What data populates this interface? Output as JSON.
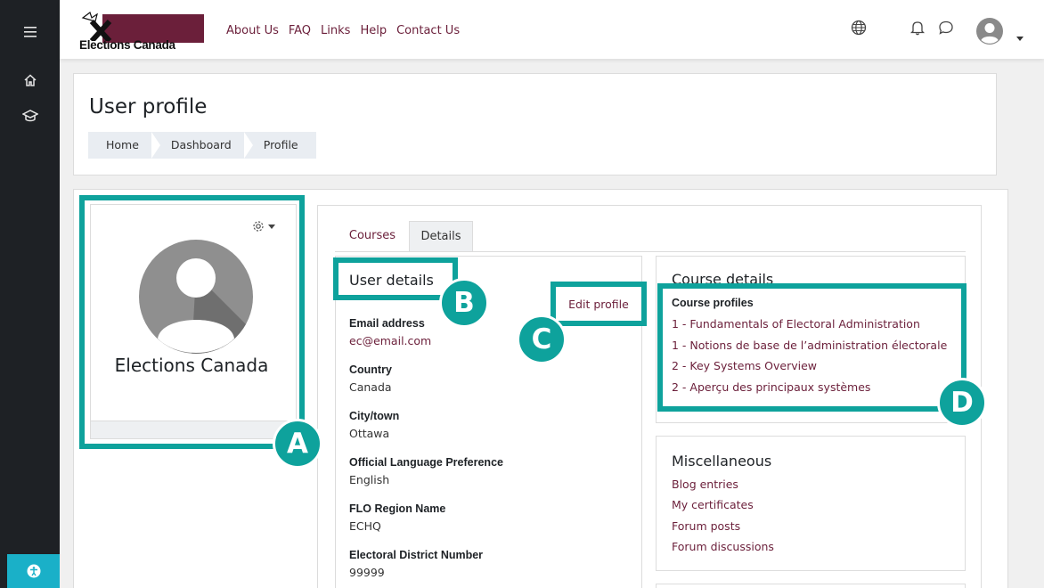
{
  "nav": {
    "brand": "Elections Canada",
    "links": [
      "About Us",
      "FAQ",
      "Links",
      "Help",
      "Contact Us"
    ]
  },
  "icons": {
    "menu": "menu-icon",
    "home": "home-icon",
    "courses": "graduation-cap-icon",
    "language": "globe-icon",
    "notifications": "bell-icon",
    "messages": "chat-bubble-icon",
    "accessibility": "accessibility-icon"
  },
  "page": {
    "title": "User profile",
    "breadcrumbs": [
      "Home",
      "Dashboard",
      "Profile"
    ]
  },
  "profile": {
    "name": "Elections Canada"
  },
  "tabs": [
    "Courses",
    "Details"
  ],
  "user_details": {
    "title": "User details",
    "edit_label": "Edit profile",
    "fields": [
      {
        "label": "Email address",
        "value": "ec@email.com"
      },
      {
        "label": "Country",
        "value": "Canada"
      },
      {
        "label": "City/town",
        "value": "Ottawa"
      },
      {
        "label": "Official Language Preference",
        "value": "English"
      },
      {
        "label": "FLO Region Name",
        "value": "ECHQ"
      },
      {
        "label": "Electoral District Number",
        "value": "99999"
      }
    ]
  },
  "course_details": {
    "title": "Course details",
    "subtitle": "Course profiles",
    "courses": [
      "1 - Fundamentals of Electoral Administration",
      "1 - Notions de base de l’administration électorale",
      "2 - Key Systems Overview",
      "2 - Aperçu des principaux systèmes"
    ]
  },
  "misc": {
    "title": "Miscellaneous",
    "links": [
      "Blog entries",
      "My certificates",
      "Forum posts",
      "Forum discussions"
    ]
  },
  "callouts": [
    "A",
    "B",
    "C",
    "D"
  ],
  "colors": {
    "accent": "#0ea29c",
    "brand": "#6b1f3a",
    "rail": "#1e2125"
  }
}
